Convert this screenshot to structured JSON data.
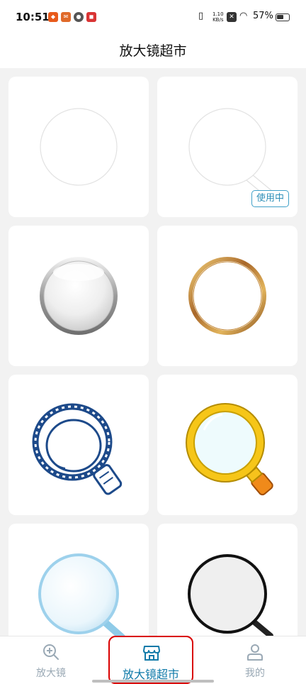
{
  "status_bar": {
    "time": "10:51",
    "net_speed": "1.10",
    "net_unit": "KB/s",
    "battery": "57%"
  },
  "header": {
    "title": "放大镜超市"
  },
  "cards": [
    {
      "style": "plain-circle",
      "in_use": false
    },
    {
      "style": "plain-with-handle",
      "in_use": true,
      "badge": "使用中"
    },
    {
      "style": "silver-glass",
      "in_use": false
    },
    {
      "style": "gold-ring",
      "in_use": false
    },
    {
      "style": "blue-sketch",
      "in_use": false
    },
    {
      "style": "yellow-cartoon",
      "in_use": false
    },
    {
      "style": "blue-glass",
      "in_use": false
    },
    {
      "style": "black-ring",
      "in_use": false
    }
  ],
  "tabs": [
    {
      "label": "放大镜",
      "icon": "magnifier-plus-icon",
      "active": false
    },
    {
      "label": "放大镜超市",
      "icon": "store-icon",
      "active": true
    },
    {
      "label": "我的",
      "icon": "user-icon",
      "active": false
    }
  ],
  "colors": {
    "accent": "#0e79a8",
    "inactive": "#9aa9b5",
    "highlight": "#d90000"
  }
}
